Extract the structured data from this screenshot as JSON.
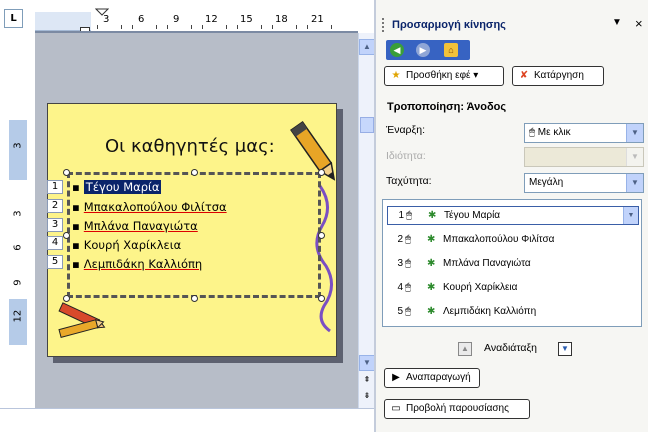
{
  "ruler": {
    "corner_label": "L",
    "top_numbers": [
      "3",
      "6",
      "9",
      "12",
      "15",
      "18",
      "21"
    ],
    "side_numbers": [
      "3",
      "3",
      "6",
      "9",
      "12"
    ]
  },
  "slide": {
    "title": "Οι καθηγητές μας:",
    "bullets": [
      {
        "num": "1",
        "text": "Τέγου Μαρία"
      },
      {
        "num": "2",
        "text": "Μπακαλοπούλου Φιλίτσα"
      },
      {
        "num": "3",
        "text": "Μπλάνα Παναγιώτα"
      },
      {
        "num": "4",
        "text": "Κουρή Χαρίκλεια"
      },
      {
        "num": "5",
        "text": "Λεμπιδάκη Καλλιόπη"
      }
    ]
  },
  "pane": {
    "title": "Προσαρμογή κίνησης",
    "menu_icon": "▼",
    "close_icon": "×",
    "add_effect_label": "Προσθήκη εφέ",
    "remove_label": "Κατάργηση",
    "section_title": "Τροποποίηση: Άνοδος",
    "start_label": "Έναρξη:",
    "start_value": "Με κλικ",
    "property_label": "Ιδιότητα:",
    "property_value": "",
    "speed_label": "Ταχύτητα:",
    "speed_value": "Μεγάλη",
    "animations": [
      {
        "num": "1",
        "name": "Τέγου Μαρία",
        "selected": true
      },
      {
        "num": "2",
        "name": "Μπακαλοπούλου Φιλίτσα",
        "selected": false
      },
      {
        "num": "3",
        "name": "Μπλάνα Παναγιώτα",
        "selected": false
      },
      {
        "num": "4",
        "name": "Κουρή Χαρίκλεια",
        "selected": false
      },
      {
        "num": "5",
        "name": "Λεμπιδάκη Καλλιόπη",
        "selected": false
      }
    ],
    "reorder_label": "Αναδιάταξη",
    "play_label": "Αναπαραγωγή",
    "slideshow_label": "Προβολή παρουσίασης"
  },
  "colors": {
    "slide_bg": "#fdf48a",
    "pane_title": "#0a246a",
    "selection": "#0a246a",
    "nav_bar": "#3763c2"
  }
}
